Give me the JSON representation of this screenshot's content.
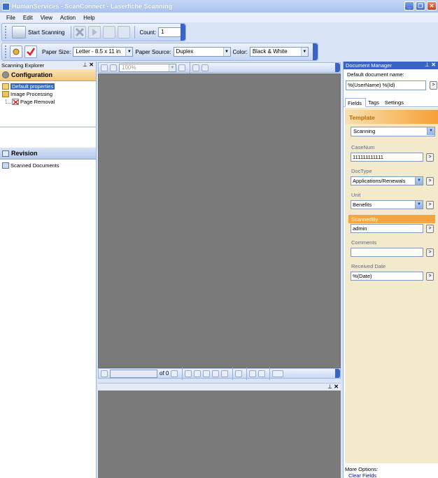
{
  "window": {
    "title": "HumanServices - ScanConnect - Laserfiche Scanning"
  },
  "menu": [
    "File",
    "Edit",
    "View",
    "Action",
    "Help"
  ],
  "toolbar1": {
    "start_scanning": "Start Scanning",
    "count_label": "Count:",
    "count_value": "1"
  },
  "toolbar2": {
    "paper_size_label": "Paper Size:",
    "paper_size_value": "Letter - 8.5 x 11 in",
    "paper_source_label": "Paper Source:",
    "paper_source_value": "Duplex",
    "color_label": "Color:",
    "color_value": "Black & White"
  },
  "explorer": {
    "title": "Scanning Explorer",
    "configuration": "Configuration",
    "items": [
      "Default properties",
      "Image Processing",
      "Page Removal"
    ],
    "revision": "Revision",
    "revision_items": [
      "Scanned Documents"
    ]
  },
  "viewer": {
    "zoom": "100%",
    "page_of": "of 0"
  },
  "docmgr": {
    "title": "Document Manager",
    "default_name_label": "Default document name:",
    "default_name_value": "%(UserName) %(Id)",
    "tabs": [
      "Fields",
      "Tags",
      "Settings"
    ],
    "template_label": "Template",
    "template_value": "Scanning",
    "fields": {
      "casenum_label": "CaseNum",
      "casenum_value": "111111111111",
      "doctype_label": "DocType",
      "doctype_value": "Applications/Renewals",
      "unit_label": "Unit",
      "unit_value": "Benefits",
      "scannedby_label": "ScannedBy",
      "scannedby_value": "admin",
      "comments_label": "Comments",
      "comments_value": "",
      "received_label": "Received Date",
      "received_value": "%(Date)"
    },
    "more_options": "More Options:",
    "clear_fields": "Clear Fields"
  },
  "colors": {
    "accent": "#3a64c4",
    "template_orange": "#f6a035",
    "viewer_gray": "#7a7a7a"
  }
}
